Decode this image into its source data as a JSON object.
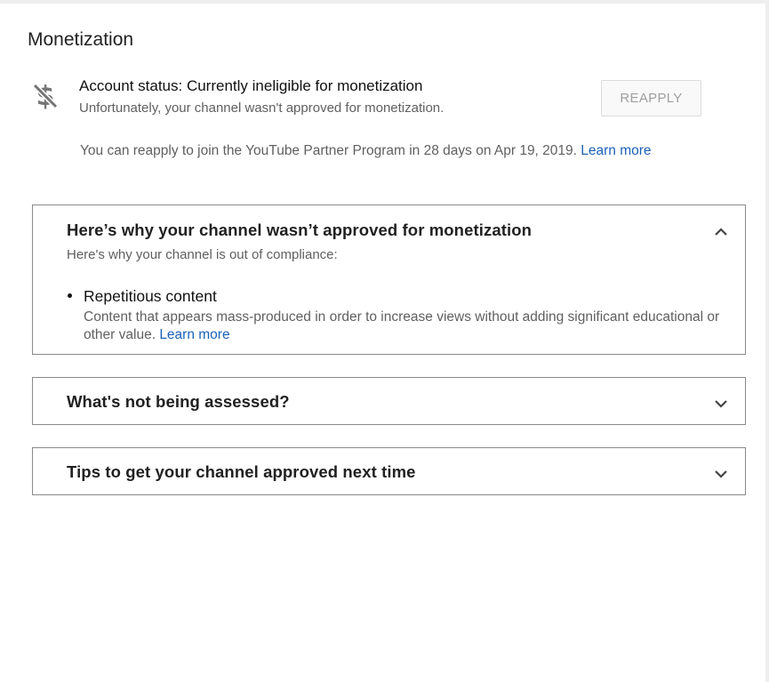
{
  "page": {
    "title": "Monetization"
  },
  "status": {
    "icon": "money-off-icon",
    "title": "Account status: Currently ineligible for monetization",
    "subtitle": "Unfortunately, your channel wasn't approved for monetization.",
    "reapply_label": "REAPPLY",
    "reapply_note": "You can reapply to join the YouTube Partner Program in 28 days on Apr 19, 2019.",
    "reapply_link": "Learn more"
  },
  "panels": [
    {
      "title": "Here’s why your channel wasn’t approved for monetization",
      "expanded": true,
      "chevron": "chevron-up-icon",
      "description": "Here's why your channel is out of compliance:",
      "reasons": [
        {
          "title": "Repetitious content",
          "description": "Content that appears mass-produced in order to increase views without adding significant educational or other value.",
          "link": "Learn more"
        }
      ]
    },
    {
      "title": "What's not being assessed?",
      "expanded": false,
      "chevron": "chevron-down-icon"
    },
    {
      "title": "Tips to get your channel approved next time",
      "expanded": false,
      "chevron": "chevron-down-icon"
    }
  ],
  "colors": {
    "link": "#1c62b9",
    "secondary_text": "#606060",
    "border": "#8a8a8a",
    "button_text_disabled": "#9e9e9e"
  }
}
